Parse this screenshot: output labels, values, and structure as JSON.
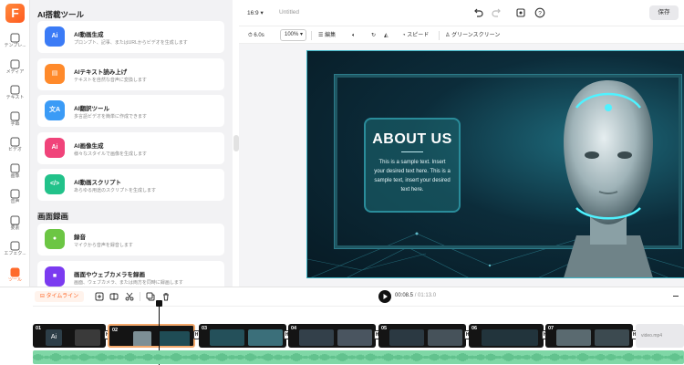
{
  "app": {
    "logo_letter": "F",
    "title": "Untitled",
    "aspect_ratio": "16:9",
    "save_label": "保存"
  },
  "rail": [
    {
      "label": "テンプレ...",
      "icon": "grid-icon"
    },
    {
      "label": "メディア",
      "icon": "media-icon"
    },
    {
      "label": "テキスト",
      "icon": "text-icon"
    },
    {
      "label": "字幕",
      "icon": "subtitle-icon"
    },
    {
      "label": "ビデオ",
      "icon": "video-icon"
    },
    {
      "label": "画像",
      "icon": "image-icon"
    },
    {
      "label": "音声",
      "icon": "music-icon"
    },
    {
      "label": "要素",
      "icon": "elements-icon"
    },
    {
      "label": "エフェク...",
      "icon": "effects-icon"
    },
    {
      "label": "ツール",
      "icon": "tools-icon",
      "active": true
    }
  ],
  "panel": {
    "ai_section": "AI搭載ツール",
    "rec_section": "画面録画",
    "tools": [
      {
        "title": "AI動画生成",
        "desc": "プロンプト、記事、またはURLからビデオを生成します",
        "icon_text": "Ai",
        "color": "#3b7bf6"
      },
      {
        "title": "AIテキスト読み上げ",
        "desc": "テキストを自然な音声に変換します",
        "icon_text": "▤",
        "color": "#ff8a2b"
      },
      {
        "title": "AI翻訳ツール",
        "desc": "多言語ビデオを簡単に作成できます",
        "icon_text": "文A",
        "color": "#3b9bf6"
      },
      {
        "title": "AI画像生成",
        "desc": "様々なスタイルで画像を生成します",
        "icon_text": "Ai",
        "color": "#f0447a"
      },
      {
        "title": "AI動画スクリプト",
        "desc": "あらゆる用途のスクリプトを生成します",
        "icon_text": "</>",
        "color": "#22c28a"
      }
    ],
    "rec_tools": [
      {
        "title": "録音",
        "desc": "マイクから音声を録音します",
        "icon_text": "●",
        "color": "#6cc644"
      },
      {
        "title": "画面やウェブカメラを録画",
        "desc": "画面、ウェブカメラ、または両方を同時に録画します",
        "icon_text": "■",
        "color": "#7b3bf0"
      }
    ]
  },
  "toolbar": {
    "duration": "6.0s",
    "zoom": "100%",
    "edit": "編集",
    "speed": "スピード",
    "green_screen": "グリーンスクリーン"
  },
  "slide": {
    "title": "ABOUT US",
    "body": "This is a sample text. Insert your desired text here. This is a sample text, insert your desired text here."
  },
  "timeline": {
    "label": "タイムライン",
    "current_time": "00:08.5",
    "total_time": "/ 01:13.0",
    "clips": [
      "01",
      "02",
      "03",
      "04",
      "05",
      "06",
      "07"
    ],
    "ghost_clip": "video.mp4"
  }
}
